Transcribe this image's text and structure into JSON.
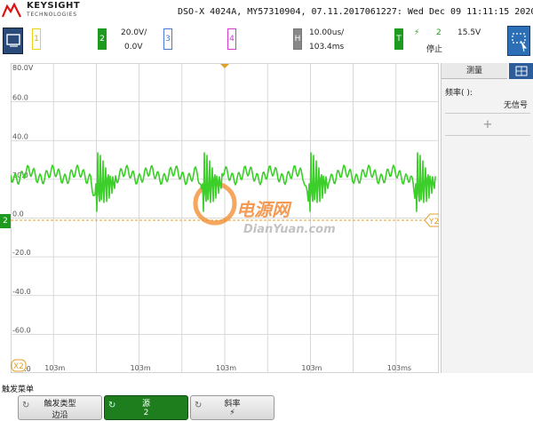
{
  "brand": {
    "name": "KEYSIGHT",
    "sub": "TECHNOLOGIES"
  },
  "scope_id": "DSO-X 4024A, MY57310904, 07.11.2017061227: Wed Dec 09 11:11:15 2020",
  "channels": {
    "ch1": {
      "label": "1",
      "color": "#e8d21a"
    },
    "ch2": {
      "label": "2",
      "scale": "20.0V/",
      "offset": "0.0V",
      "color": "#1e9a1e"
    },
    "ch3": {
      "label": "3",
      "color": "#4a78d4"
    },
    "ch4": {
      "label": "4",
      "color": "#d43bd4"
    }
  },
  "horizontal": {
    "label": "H",
    "scale": "10.00us/",
    "position": "103.4ms"
  },
  "trigger": {
    "label": "T",
    "source": "2",
    "level": "15.5V",
    "status": "停止",
    "color": "#1e9a1e"
  },
  "yaxis": [
    "80.0V",
    "60.0",
    "40.0",
    "20.0",
    "0.0",
    "-20.0",
    "-40.0",
    "-60.0",
    "-80.0"
  ],
  "xaxis": [
    "103m",
    "103m",
    "103m",
    "103m",
    "103ms"
  ],
  "markers": {
    "x2": "X2",
    "y2": "Y2",
    "t": "T",
    "ch2": "2"
  },
  "watermark": {
    "text_cn": "电源网",
    "text_en": "DianYuan.com"
  },
  "measure": {
    "tab": "测量",
    "freq_label": "频率(  ):",
    "freq_value": "无信号",
    "add": "+"
  },
  "menu": {
    "title": "触发菜单",
    "softkeys": [
      {
        "label": "触发类型",
        "value": "边沿",
        "active": false
      },
      {
        "label": "源",
        "value": "2",
        "active": true
      },
      {
        "label": "斜率",
        "value": "⚡",
        "active": false
      }
    ]
  },
  "trace_color": "#3ccf2a",
  "ref_color": "#e2a02a"
}
